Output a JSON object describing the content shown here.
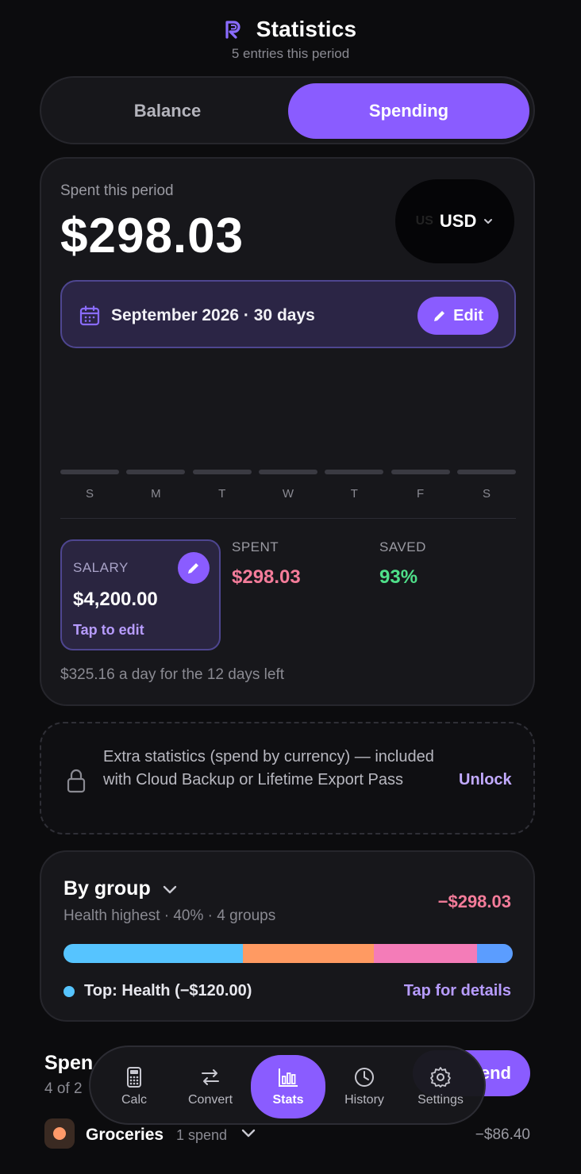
{
  "header": {
    "title": "Statistics",
    "subtitle": "5 entries this period",
    "logo_icon": "app-logo-r"
  },
  "segment": {
    "balance_label": "Balance",
    "spending_label": "Spending",
    "selected": "Spending"
  },
  "summary": {
    "spent_label": "Spent this period",
    "spent_amount": "$298.03",
    "currency_flag": "US",
    "currency_code": "USD",
    "period_text": "September 2026 · 30 days",
    "edit_label": "Edit",
    "week_days": [
      "S",
      "M",
      "T",
      "W",
      "T",
      "F",
      "S"
    ],
    "salary": {
      "label": "SALARY",
      "value": "$4,200.00",
      "hint": "Tap to edit"
    },
    "spent": {
      "label": "SPENT",
      "value": "$298.03"
    },
    "saved": {
      "label": "SAVED",
      "value": "93%"
    },
    "per_day_text": "$325.16 a day for the 12 days left"
  },
  "unlock": {
    "text": "Extra statistics (spend by currency) — included with Cloud Backup or Lifetime Export Pass",
    "button_label": "Unlock"
  },
  "groups": {
    "title": "By group",
    "subtitle": "Health highest · 40% · 4 groups",
    "total": "−$298.03",
    "segments": [
      {
        "share": 0.4,
        "color": "#56c4ff"
      },
      {
        "share": 0.29,
        "color": "#ff9a62"
      },
      {
        "share": 0.23,
        "color": "#f47cb8"
      },
      {
        "share": 0.08,
        "color": "#5b9dff"
      }
    ],
    "top_text": "Top: Health (−$120.00)",
    "details_label": "Tap for details"
  },
  "spends": {
    "title": "Spen",
    "subtitle": "4 of 2",
    "add_label": "end",
    "rows": [
      {
        "name": "Groceries",
        "count": "1 spend",
        "amount": "−$86.40"
      }
    ]
  },
  "nav": {
    "items": [
      {
        "label": "Calc",
        "icon": "calculator-icon"
      },
      {
        "label": "Convert",
        "icon": "swap-icon"
      },
      {
        "label": "Stats",
        "icon": "bar-chart-icon"
      },
      {
        "label": "History",
        "icon": "clock-icon"
      },
      {
        "label": "Settings",
        "icon": "gear-icon"
      }
    ],
    "active": "Stats"
  },
  "colors": {
    "accent": "#8a5cff",
    "spent": "#f47c9a",
    "saved": "#4fe08a",
    "background": "#0c0c0e"
  }
}
